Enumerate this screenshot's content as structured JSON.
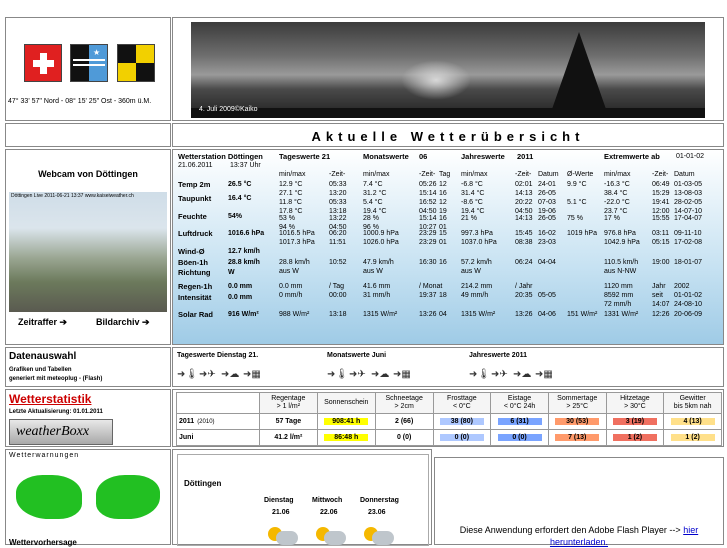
{
  "location": {
    "coords": "47° 33' 57\" Nord - 08° 15' 25\" Ost - 360m ü.M."
  },
  "banner": {
    "caption": "4. Juli 2009©Kaiko"
  },
  "title": "Aktuelle Wetterübersicht",
  "webcam": {
    "heading": "Webcam von Döttingen",
    "overlay": "Döttingen Live  2011-06-21 13:37  www.kaiseiweather.ch",
    "timelapse_link": "Zeitraffer ➔",
    "archive_link": "Bildarchiv ➔"
  },
  "station": {
    "name": "Wetterstation Döttingen",
    "date": "21.06.2011",
    "time": "13:37 Uhr",
    "rows": [
      {
        "label": "Temp 2m",
        "value": "26.5 °C"
      },
      {
        "label": "Taupunkt",
        "value": "16.4 °C"
      },
      {
        "label": "Feuchte",
        "value": "54%"
      },
      {
        "label": "Luftdruck",
        "value": "1016.6 hPa"
      },
      {
        "label": "Wind-Ø",
        "value": "12.7 km/h"
      },
      {
        "label": "Böen-1h",
        "value": "28.8 km/h"
      },
      {
        "label": "Richtung",
        "value": "W"
      },
      {
        "label": "Regen-1h",
        "value": "0.0 mm"
      },
      {
        "label": "Intensität",
        "value": "0.0 mm"
      },
      {
        "label": "Solar Rad",
        "value": "916 W/m²"
      }
    ]
  },
  "day": {
    "heading": "Tageswerte 21",
    "sub": [
      "min/max",
      "-Zeit-"
    ],
    "rows": [
      [
        "12.9 °C\n27.1 °C",
        "05:33\n13:20"
      ],
      [
        "11.8 °C\n17.8 °C",
        "05:33\n13:18"
      ],
      [
        "53 %\n94 %",
        "13:22\n04:50"
      ],
      [
        "1016.5 hPa\n1017.3 hPa",
        "06:20\n11:51"
      ],
      [
        "",
        ""
      ],
      [
        "28.8 km/h\naus W",
        "10:52"
      ],
      [
        "",
        ""
      ],
      [
        "0.0 mm\n0 mm/h",
        "/ Tag\n00:00"
      ],
      [
        "988 W/m²",
        "13:18"
      ]
    ]
  },
  "month": {
    "heading": "Monatswerte",
    "num": "06",
    "sub": [
      "min/max",
      "-Zeit-",
      "Tag"
    ],
    "rows": [
      [
        "7.4 °C\n31.2 °C",
        "05:26\n15:14",
        "12\n16"
      ],
      [
        "5.4 °C\n19.4 °C",
        "16:52\n04:50",
        "12\n19"
      ],
      [
        "28 %\n96 %",
        "15:14\n10:27",
        "16\n01"
      ],
      [
        "1000.9 hPa\n1026.0 hPa",
        "23:29\n23:29",
        "15\n01"
      ],
      [
        "",
        "",
        ""
      ],
      [
        "47.9 km/h\naus W",
        "16:30",
        "16"
      ],
      [
        "",
        "",
        ""
      ],
      [
        "41.6 mm\n31 mm/h",
        "/ Monat\n19:37",
        "\n18"
      ],
      [
        "1315 W/m²",
        "13:26",
        "04"
      ]
    ]
  },
  "year": {
    "heading": "Jahreswerte",
    "num": "2011",
    "sub": [
      "min/max",
      "-Zeit-",
      "Datum",
      "Ø-Werte"
    ],
    "rows": [
      [
        "-6.8 °C\n31.4 °C",
        "02:01\n14:13",
        "24-01\n26-05",
        "9.9 °C"
      ],
      [
        "-8.6 °C\n19.4 °C",
        "20:22\n04:50",
        "07-03\n19-06",
        "5.1 °C"
      ],
      [
        "21 %",
        "14:13",
        "26-05",
        "75 %"
      ],
      [
        "997.3 hPa\n1037.0 hPa",
        "15:45\n08:38",
        "16-02\n23-03",
        "1019 hPa"
      ],
      [
        "",
        "",
        "",
        ""
      ],
      [
        "57.2 km/h\naus W",
        "06:24",
        "04-04",
        ""
      ],
      [
        "",
        "",
        "",
        ""
      ],
      [
        "214.2 mm\n49 mm/h",
        "/ Jahr\n20:35",
        "\n05-05",
        ""
      ],
      [
        "1315 W/m²",
        "13:26",
        "04-06",
        "151 W/m²"
      ]
    ]
  },
  "extreme": {
    "heading": "Extremwerte ab",
    "since": "01-01-02",
    "sub": [
      "min/max",
      "-Zeit-",
      "Datum"
    ],
    "rows": [
      [
        "-16.3 °C\n38.4 °C",
        "06:49\n15:29",
        "01-03-05\n13-08-03"
      ],
      [
        "-22.0 °C\n23.7 °C",
        "19:41\n12:00",
        "28-02-05\n14-07-10"
      ],
      [
        "17 %",
        "15:55",
        "17-04-07"
      ],
      [
        "976.8 hPa\n1042.9 hPa",
        "03:11\n05:15",
        "09-11-10\n17-02-08"
      ],
      [
        "",
        "",
        ""
      ],
      [
        "110.5 km/h\naus N-NW",
        "19:00",
        "18-01-07"
      ],
      [
        "",
        "",
        ""
      ],
      [
        "1120 mm\n8592 mm\n72 mm/h",
        "Jahr\nseit\n14:07",
        "2002\n01-01-02\n24-08-10"
      ],
      [
        "1331 W/m²",
        "12:26",
        "20-06-09"
      ]
    ]
  },
  "data": {
    "heading": "Datenauswahl",
    "line1": "Grafiken und Tabellen",
    "line2": "generiert mit meteoplug - (Flash)",
    "groups": [
      "Tageswerte Dienstag 21.",
      "Monatswerte Juni",
      "Jahreswerte 2011"
    ]
  },
  "stats": {
    "heading": "Wetterstatistik",
    "updated": "Letzte Aktualisierung: 01.01.2011",
    "logo": "weatherBoxx",
    "headers": [
      "Regentage\n> 1 l/m²",
      "Sonnenschein",
      "Schneetage\n> 2cm",
      "Frosttage\n< 0°C",
      "Eistage\n< 0°C 24h",
      "Sommertage\n> 25°C",
      "Hitzetage\n> 30°C",
      "Gewitter\nbis 5km nah"
    ],
    "rows": [
      {
        "label": "2011",
        "sub": "(2010)",
        "cells": [
          "57 Tage",
          "908:41 h",
          "2 (66)",
          "38 (80)",
          "6 (31)",
          "30 (53)",
          "3 (19)",
          "4 (13)"
        ]
      },
      {
        "label": "Juni",
        "sub": "",
        "cells": [
          "41.2 l/m²",
          "86:48 h",
          "0 (0)",
          "0 (0)",
          "0 (0)",
          "7 (13)",
          "1 (2)",
          "1 (2)"
        ]
      }
    ],
    "colors": [
      "#ffffff",
      "#ffff00",
      "#ffffff",
      "#aec8ff",
      "#7aa4ff",
      "#ff9a6b",
      "#f07060",
      "#ffe08a"
    ]
  },
  "warnings": {
    "heading": "Wetterwarnungen",
    "forecast_heading": "Wettervorhersage"
  },
  "forecast": {
    "place": "Döttingen",
    "days": [
      {
        "name": "Dienstag",
        "date": "21.06"
      },
      {
        "name": "Mittwoch",
        "date": "22.06"
      },
      {
        "name": "Donnerstag",
        "date": "23.06"
      }
    ]
  },
  "flash": {
    "text": "Diese Anwendung erfordert den Adobe Flash Player -->",
    "link1": "hier",
    "link2": "herunterladen."
  }
}
